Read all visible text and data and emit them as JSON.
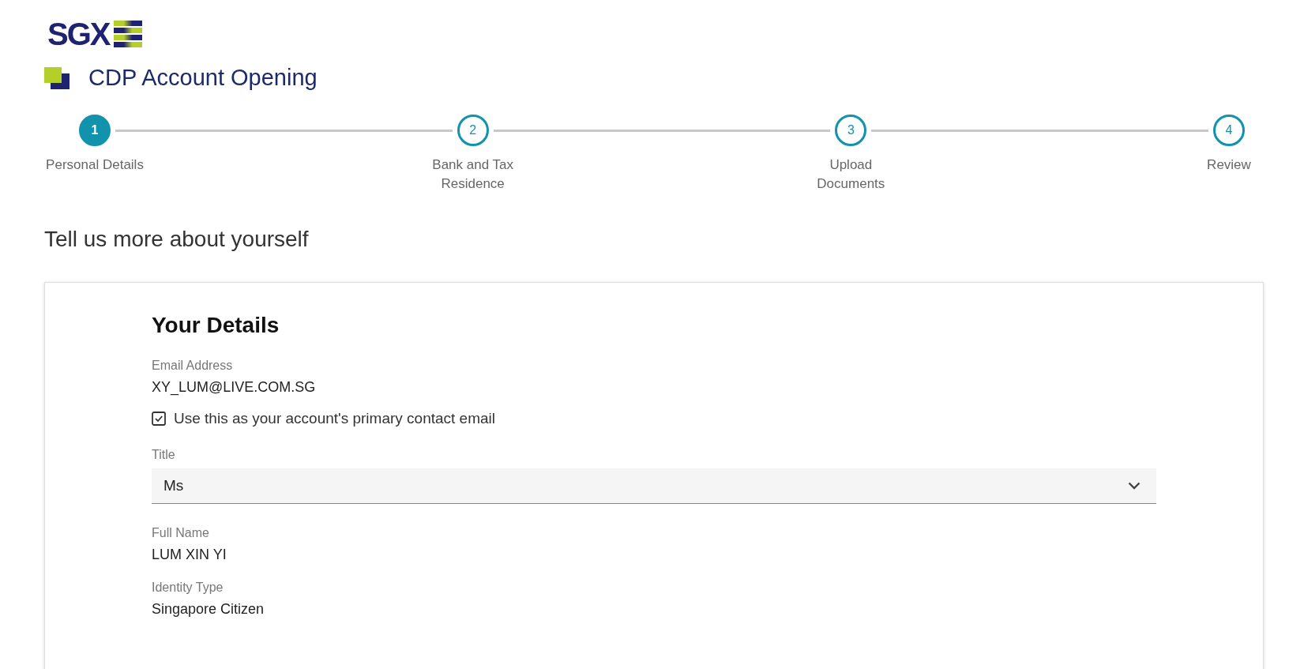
{
  "logo": {
    "text": "SGX"
  },
  "page_title": "CDP Account Opening",
  "stepper": [
    {
      "number": "1",
      "label": "Personal Details",
      "selected": true
    },
    {
      "number": "2",
      "label": "Bank and Tax Residence",
      "selected": false
    },
    {
      "number": "3",
      "label": "Upload Documents",
      "selected": false
    },
    {
      "number": "4",
      "label": "Review",
      "selected": false
    }
  ],
  "heading": "Tell us more about yourself",
  "card": {
    "title": "Your Details",
    "email": {
      "label": "Email Address",
      "value": "XY_LUM@LIVE.COM.SG"
    },
    "primary_contact": {
      "label": "Use this as your account's primary contact email",
      "checked": true
    },
    "title_select": {
      "label": "Title",
      "value": "Ms"
    },
    "fields": [
      {
        "label": "Full Name",
        "value": "LUM XIN YI"
      },
      {
        "label": "Identity Type",
        "value": "Singapore Citizen"
      }
    ]
  }
}
